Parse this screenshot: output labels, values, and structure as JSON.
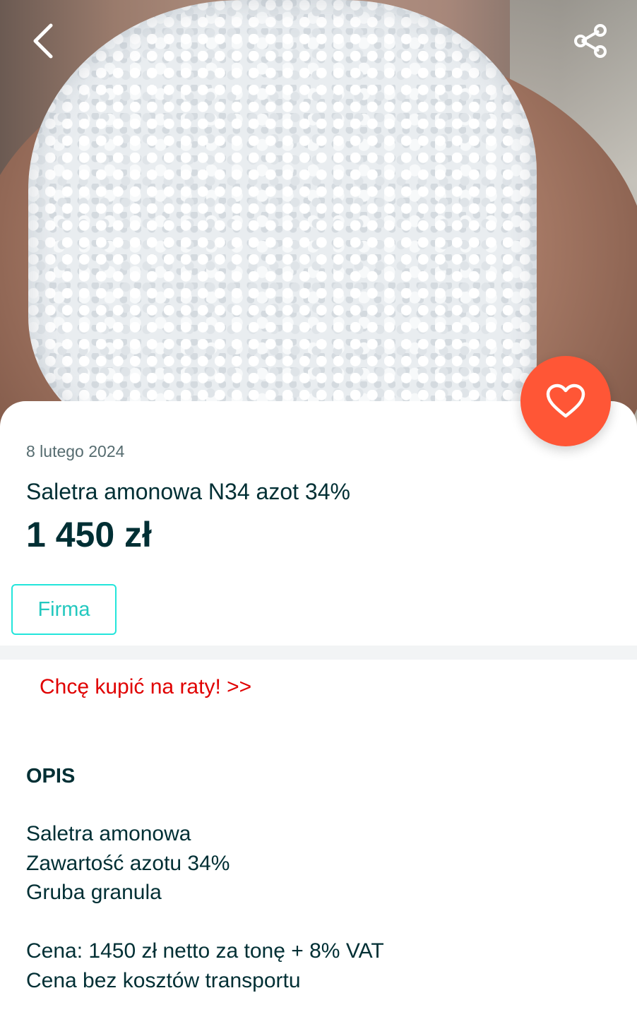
{
  "hero": {
    "image_description_icon": "fertilizer-granules-photo",
    "back_icon": "chevron-left-icon",
    "share_icon": "share-icon"
  },
  "favorite": {
    "icon": "heart-outline-icon",
    "color": "#ff5636"
  },
  "listing": {
    "date": "8 lutego 2024",
    "title": "Saletra amonowa N34 azot 34%",
    "price": "1 450 zł",
    "seller_type_badge": "Firma"
  },
  "installments_link": "Chcę kupić na raty! >>",
  "description": {
    "heading": "OPIS",
    "lines": [
      "Saletra amonowa",
      "Zawartość azotu 34%",
      "Gruba granula",
      "",
      "Cena: 1450 zł netto za tonę + 8% VAT",
      "Cena bez kosztów transportu"
    ]
  },
  "colors": {
    "text_primary": "#002f34",
    "badge_accent": "#23e5db",
    "link_red": "#e00000"
  }
}
